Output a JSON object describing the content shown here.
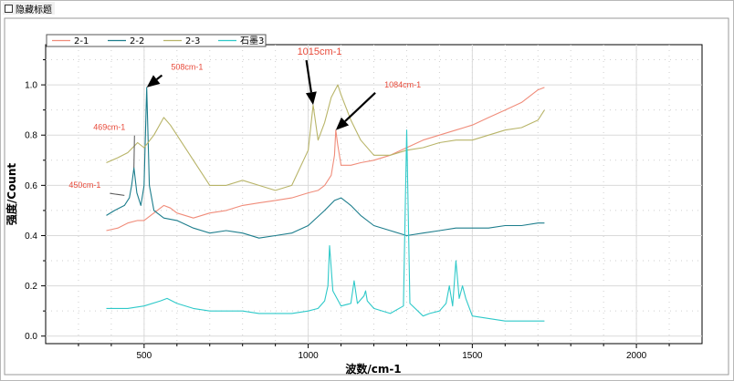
{
  "window": {
    "hide_title_label": "隐藏标题",
    "hide_title_checked": false
  },
  "chart_data": {
    "type": "line",
    "xlabel": "波数/cm-1",
    "ylabel": "强度/Count",
    "xlim": [
      200,
      2200
    ],
    "ylim": [
      -0.03,
      1.16
    ],
    "x_ticks": [
      500,
      1000,
      1500,
      2000
    ],
    "y_ticks": [
      0.0,
      0.2,
      0.4,
      0.6,
      0.8,
      1.0
    ],
    "y_tick_labels": [
      "0.0",
      "0.2",
      "0.4",
      "0.6",
      "0.8",
      "1.0"
    ],
    "x_tick_labels": [
      "500",
      "1000",
      "1500",
      "2000"
    ],
    "grid": true,
    "legend_position": "top-left",
    "series": [
      {
        "name": "2-1",
        "color": "#f08c7a",
        "x": [
          385,
          420,
          450,
          480,
          500,
          530,
          560,
          580,
          600,
          650,
          700,
          750,
          800,
          850,
          900,
          950,
          1000,
          1030,
          1050,
          1070,
          1080,
          1084,
          1090,
          1100,
          1130,
          1160,
          1200,
          1250,
          1300,
          1350,
          1400,
          1450,
          1500,
          1550,
          1600,
          1650,
          1700,
          1720
        ],
        "y": [
          0.42,
          0.43,
          0.45,
          0.46,
          0.46,
          0.49,
          0.52,
          0.51,
          0.49,
          0.47,
          0.49,
          0.5,
          0.52,
          0.53,
          0.54,
          0.55,
          0.57,
          0.58,
          0.6,
          0.64,
          0.72,
          0.82,
          0.76,
          0.68,
          0.68,
          0.69,
          0.7,
          0.72,
          0.75,
          0.78,
          0.8,
          0.82,
          0.84,
          0.87,
          0.9,
          0.93,
          0.98,
          0.99
        ]
      },
      {
        "name": "2-2",
        "color": "#1c7d8c",
        "x": [
          385,
          410,
          440,
          455,
          462,
          469,
          478,
          490,
          500,
          508,
          516,
          530,
          560,
          600,
          650,
          700,
          750,
          800,
          850,
          900,
          950,
          1000,
          1050,
          1080,
          1100,
          1130,
          1160,
          1200,
          1250,
          1300,
          1350,
          1400,
          1450,
          1500,
          1550,
          1600,
          1650,
          1700,
          1720
        ],
        "y": [
          0.48,
          0.5,
          0.52,
          0.55,
          0.6,
          0.67,
          0.57,
          0.52,
          0.6,
          0.99,
          0.6,
          0.5,
          0.47,
          0.46,
          0.43,
          0.41,
          0.42,
          0.41,
          0.39,
          0.4,
          0.41,
          0.44,
          0.5,
          0.54,
          0.55,
          0.52,
          0.48,
          0.44,
          0.42,
          0.4,
          0.41,
          0.42,
          0.43,
          0.43,
          0.43,
          0.44,
          0.44,
          0.45,
          0.45
        ]
      },
      {
        "name": "2-3",
        "color": "#b8b468",
        "x": [
          385,
          420,
          450,
          480,
          500,
          530,
          560,
          580,
          600,
          650,
          700,
          750,
          800,
          850,
          900,
          950,
          1000,
          1015,
          1030,
          1050,
          1070,
          1090,
          1100,
          1130,
          1160,
          1200,
          1250,
          1300,
          1350,
          1400,
          1450,
          1500,
          1550,
          1600,
          1650,
          1700,
          1720
        ],
        "y": [
          0.69,
          0.71,
          0.73,
          0.77,
          0.75,
          0.8,
          0.87,
          0.84,
          0.8,
          0.7,
          0.6,
          0.6,
          0.62,
          0.6,
          0.58,
          0.6,
          0.74,
          0.92,
          0.78,
          0.85,
          0.95,
          1.0,
          0.96,
          0.86,
          0.78,
          0.72,
          0.72,
          0.74,
          0.75,
          0.77,
          0.78,
          0.78,
          0.8,
          0.82,
          0.83,
          0.86,
          0.9
        ]
      },
      {
        "name": "石墨3",
        "color": "#2ec9c9",
        "x": [
          385,
          450,
          500,
          550,
          570,
          600,
          650,
          700,
          750,
          800,
          850,
          900,
          950,
          1000,
          1030,
          1050,
          1060,
          1065,
          1075,
          1100,
          1130,
          1140,
          1150,
          1170,
          1175,
          1180,
          1200,
          1250,
          1290,
          1300,
          1310,
          1350,
          1370,
          1400,
          1420,
          1430,
          1440,
          1450,
          1460,
          1470,
          1480,
          1500,
          1550,
          1600,
          1650,
          1700,
          1720
        ],
        "y": [
          0.11,
          0.11,
          0.12,
          0.14,
          0.15,
          0.13,
          0.11,
          0.1,
          0.1,
          0.1,
          0.09,
          0.09,
          0.09,
          0.1,
          0.11,
          0.14,
          0.2,
          0.36,
          0.18,
          0.12,
          0.13,
          0.22,
          0.13,
          0.16,
          0.18,
          0.14,
          0.11,
          0.09,
          0.12,
          0.82,
          0.13,
          0.08,
          0.09,
          0.1,
          0.13,
          0.2,
          0.12,
          0.3,
          0.15,
          0.2,
          0.15,
          0.08,
          0.07,
          0.06,
          0.06,
          0.06,
          0.06
        ]
      }
    ],
    "annotations": [
      {
        "text": "508cm-1",
        "color": "#e84a3a",
        "tip_x": 508,
        "tip_y": 0.99,
        "label_x": 610,
        "label_y": 1.06,
        "arrow": "filled"
      },
      {
        "text": "1015cm-1",
        "color": "#e84a3a",
        "tip_x": 1015,
        "tip_y": 0.92,
        "label_x": 1050,
        "label_y": 1.12,
        "arrow": "filled"
      },
      {
        "text": "1084cm-1",
        "color": "#e84a3a",
        "tip_x": 1084,
        "tip_y": 0.82,
        "label_x": 1260,
        "label_y": 0.99,
        "arrow": "filled"
      },
      {
        "text": "469cm-1",
        "color": "#e84a3a",
        "tip_x": 469,
        "tip_y": 0.67,
        "label_x": 415,
        "label_y": 0.82,
        "arrow": "line"
      },
      {
        "text": "450cm-1",
        "color": "#e84a3a",
        "tip_x": 440,
        "tip_y": 0.56,
        "label_x": 340,
        "label_y": 0.59,
        "arrow": "line"
      }
    ]
  }
}
